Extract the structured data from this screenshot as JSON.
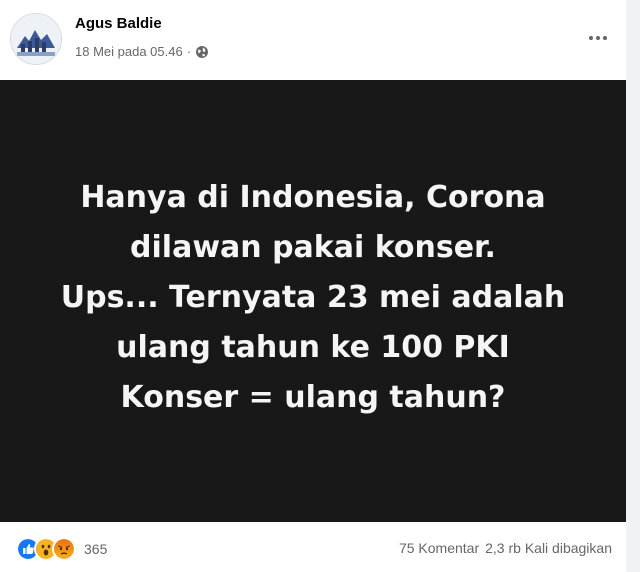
{
  "post": {
    "author": "Agus Baldie",
    "timestamp": "18 Mei pada 05.46",
    "separator": "·",
    "privacy_icon": "globe-icon",
    "more_icon": "more-dots-icon",
    "image_lines": [
      "Hanya di Indonesia, Corona",
      "dilawan pakai konser.",
      "Ups... Ternyata 23 mei adalah",
      "ulang tahun ke 100 PKI",
      "Konser = ulang tahun?"
    ]
  },
  "footer": {
    "reaction_icons": [
      "like-icon",
      "wow-icon",
      "angry-icon"
    ],
    "reaction_count": "365",
    "comments": "75 Komentar",
    "shares": "2,3 rb Kali dibagikan"
  },
  "colors": {
    "image_bg": "#181818",
    "image_text": "#f5f5f5",
    "meta_text": "#65676b",
    "like_blue": "#1877f2",
    "wow_yellow": "#f7b125",
    "angry_orange": "#e9710f"
  }
}
